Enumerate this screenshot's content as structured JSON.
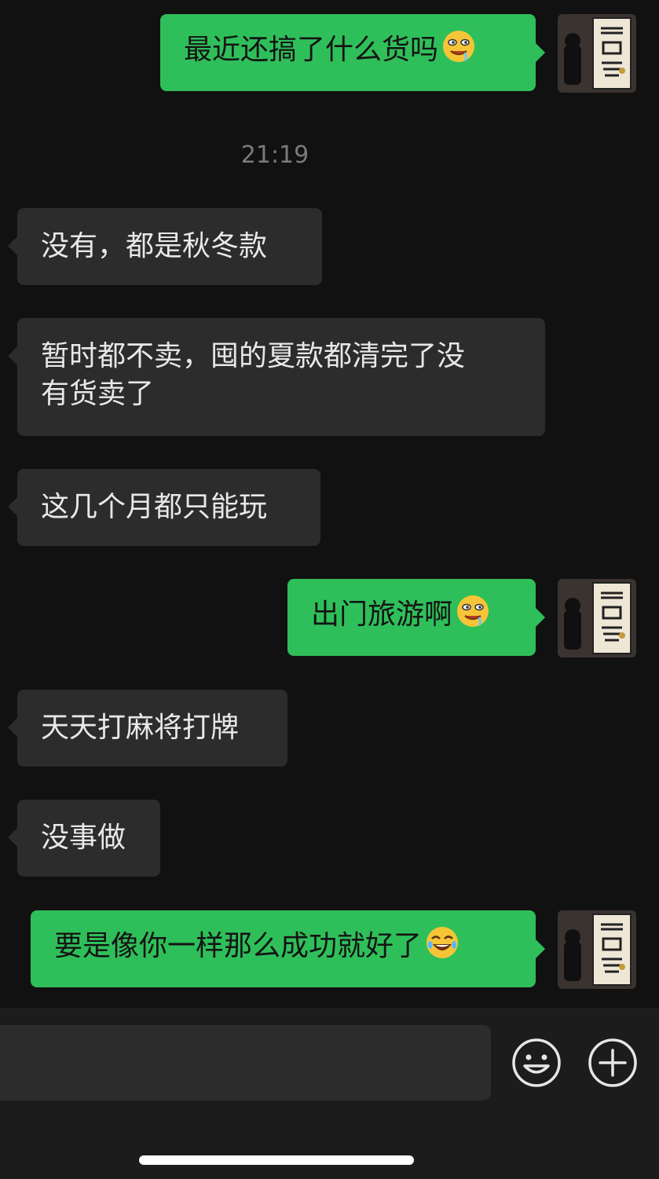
{
  "colors": {
    "background": "#111111",
    "incoming_bubble": "#2c2c2c",
    "outgoing_bubble": "#2fbf5a",
    "timestamp": "#7a7a7a"
  },
  "timestamp": "21:19",
  "messages": [
    {
      "direction": "out",
      "text": "最近还搞了什么货吗",
      "emoji": "drooling-face-emoji"
    },
    {
      "direction": "in",
      "text": "没有，都是秋冬款"
    },
    {
      "direction": "in",
      "text": "暂时都不卖，囤的夏款都清完了没",
      "text2": "有货卖了"
    },
    {
      "direction": "in",
      "text": "这几个月都只能玩"
    },
    {
      "direction": "out",
      "text": "出门旅游啊",
      "emoji": "drooling-face-emoji"
    },
    {
      "direction": "in",
      "text": "天天打麻将打牌"
    },
    {
      "direction": "in",
      "text": "没事做"
    },
    {
      "direction": "out",
      "text": "要是像你一样那么成功就好了",
      "emoji": "tears-of-joy-emoji"
    }
  ],
  "input": {
    "value": "",
    "emoji_button_icon": "smiley-face-icon",
    "more_button_icon": "plus-circle-icon"
  }
}
